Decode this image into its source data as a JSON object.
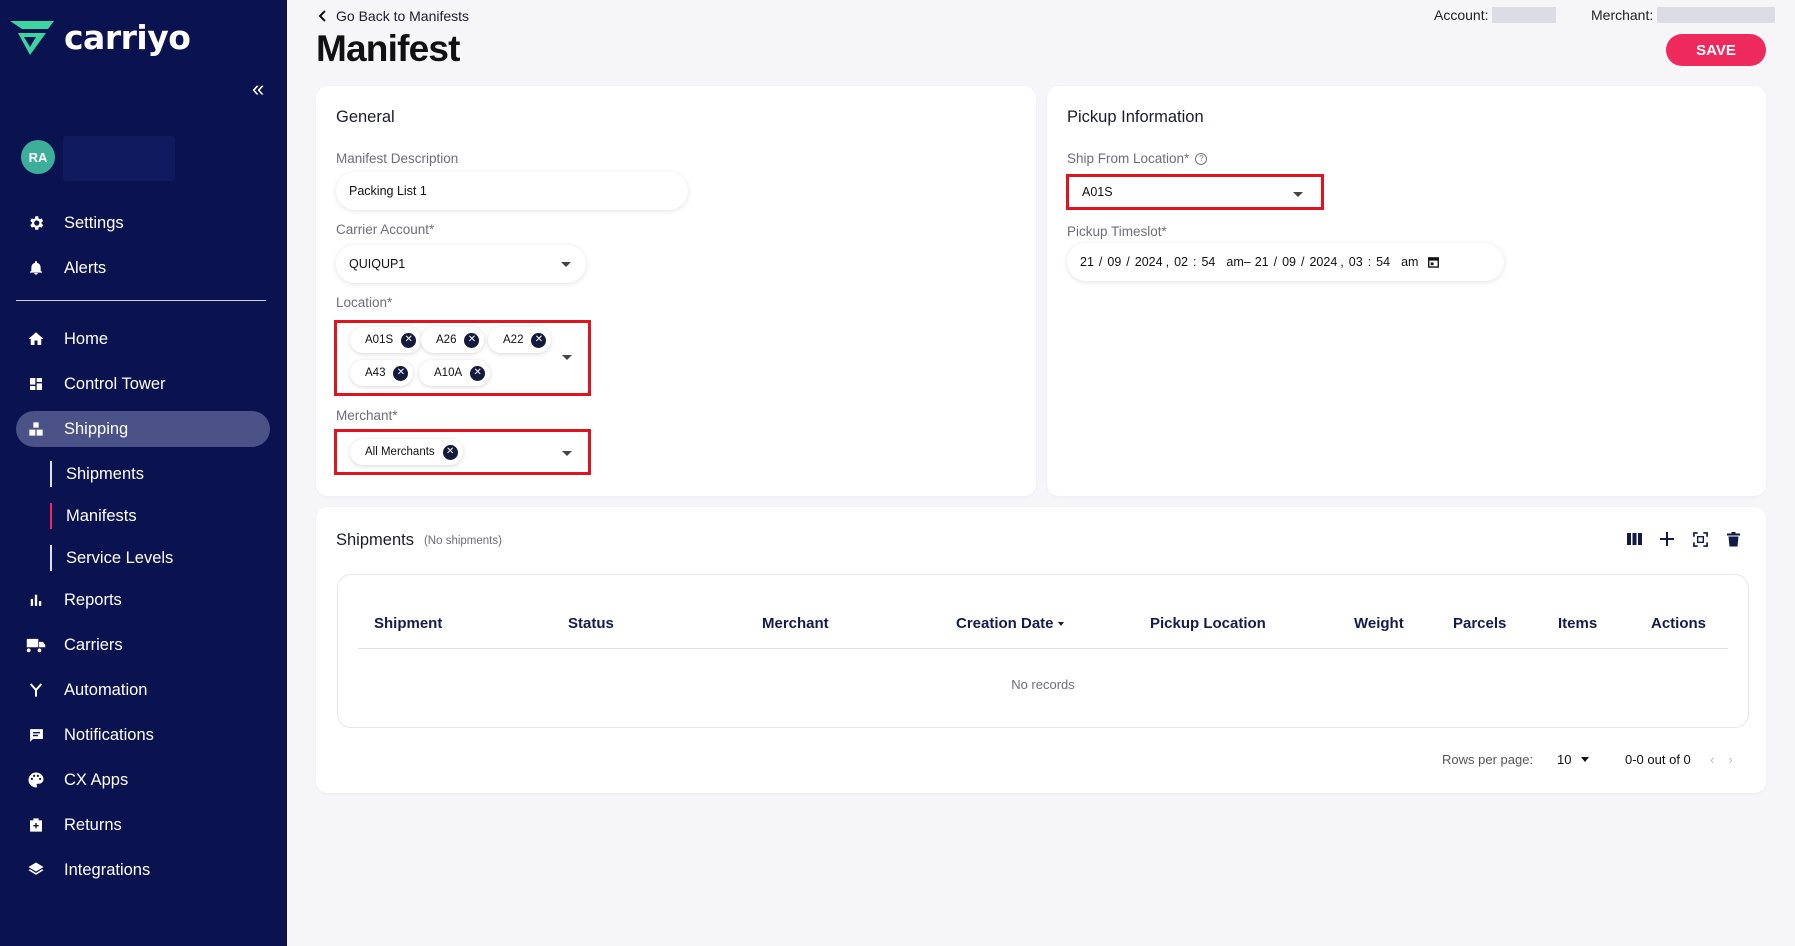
{
  "brand": {
    "name": "carriyo",
    "accent": "#ee2a5c",
    "sidebar_bg": "#0b1250",
    "logo_icon": "chevron-logo-icon"
  },
  "user": {
    "initials": "RA"
  },
  "nav_top": [
    {
      "label": "Settings",
      "icon": "gear-icon"
    },
    {
      "label": "Alerts",
      "icon": "bell-icon"
    }
  ],
  "nav_main": [
    {
      "label": "Home",
      "icon": "home-icon"
    },
    {
      "label": "Control Tower",
      "icon": "dashboard-icon"
    },
    {
      "label": "Shipping",
      "icon": "boxes-icon",
      "active": true
    },
    {
      "label": "Reports",
      "icon": "bar-chart-icon"
    },
    {
      "label": "Carriers",
      "icon": "truck-icon"
    },
    {
      "label": "Automation",
      "icon": "fork-icon"
    },
    {
      "label": "Notifications",
      "icon": "chat-icon"
    },
    {
      "label": "CX Apps",
      "icon": "palette-icon"
    },
    {
      "label": "Returns",
      "icon": "return-box-icon"
    },
    {
      "label": "Integrations",
      "icon": "layers-icon"
    }
  ],
  "nav_sub": [
    {
      "label": "Shipments"
    },
    {
      "label": "Manifests",
      "active": true
    },
    {
      "label": "Service Levels"
    }
  ],
  "header": {
    "back_label": "Go Back to Manifests",
    "title": "Manifest",
    "account_label": "Account:",
    "merchant_label": "Merchant:",
    "save_label": "SAVE"
  },
  "general": {
    "title": "General",
    "manifest_description_label": "Manifest Description",
    "manifest_description_value": "Packing List 1",
    "carrier_account_label": "Carrier Account*",
    "carrier_account_value": "QUIQUP1",
    "location_label": "Location*",
    "locations": [
      "A01S",
      "A26",
      "A22",
      "A43",
      "A10A"
    ],
    "merchant_label": "Merchant*",
    "merchants": [
      "All Merchants"
    ]
  },
  "pickup": {
    "title": "Pickup Information",
    "ship_from_label": "Ship From Location*",
    "ship_from_value": "A01S",
    "timeslot_label": "Pickup Timeslot*",
    "timeslot_start": {
      "day": "21",
      "month": "09",
      "year": "2024",
      "hour": "02",
      "minute": "54",
      "ampm": "am"
    },
    "timeslot_separator": "–",
    "timeslot_end": {
      "day": "21",
      "month": "09",
      "year": "2024",
      "hour": "03",
      "minute": "54",
      "ampm": "am"
    }
  },
  "shipments": {
    "title": "Shipments",
    "count_note": "(No shipments)",
    "columns": [
      "Shipment",
      "Status",
      "Merchant",
      "Creation Date",
      "Pickup Location",
      "Weight",
      "Parcels",
      "Items",
      "Actions"
    ],
    "empty_text": "No records",
    "rows_per_page_label": "Rows per page:",
    "rows_per_page_value": "10",
    "range_text": "0-0 out of 0"
  }
}
